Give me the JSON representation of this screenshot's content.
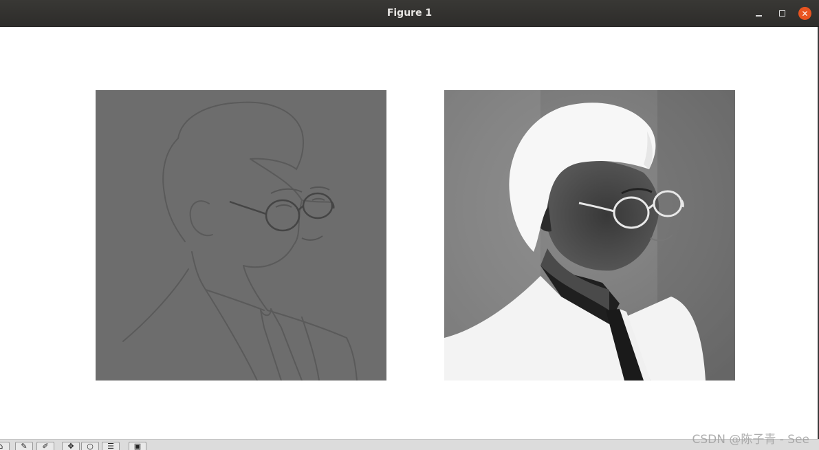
{
  "window": {
    "title": "Figure 1",
    "controls": {
      "minimize_icon": "minimize-icon",
      "maximize_icon": "maximize-icon",
      "close_icon": "close-icon"
    },
    "colors": {
      "titlebar": "#2f2e2c",
      "close_button": "#e95420",
      "background": "#ffffff"
    }
  },
  "figure": {
    "subplots": [
      {
        "content": "grayscale edge-filtered portrait (embossed outline)",
        "tone": "mid-gray"
      },
      {
        "content": "inverted grayscale portrait (negative)",
        "tone": "inverted"
      }
    ]
  },
  "toolbar": {
    "buttons": [
      {
        "icon": "home-icon"
      },
      {
        "icon": "back-icon"
      },
      {
        "icon": "forward-icon"
      },
      {
        "icon": "pan-icon"
      },
      {
        "icon": "zoom-icon"
      },
      {
        "icon": "configure-subplots-icon"
      },
      {
        "icon": "save-icon"
      }
    ]
  },
  "watermark": {
    "text": "CSDN @陈子青 - See"
  }
}
